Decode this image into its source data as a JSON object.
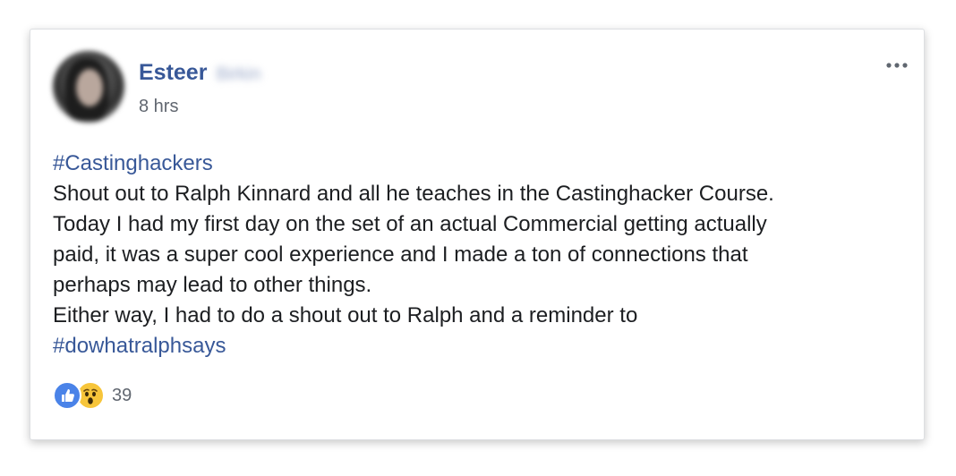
{
  "post": {
    "author_first": "Esteer",
    "author_last": "Birkin",
    "time": "8 hrs",
    "more_icon": "more-horizontal-icon",
    "hashtag_top": "#Castinghackers",
    "lines": [
      "Shout out to Ralph Kinnard and all he teaches in the Castinghacker Course.",
      "Today I had my first day on the set of an actual Commercial getting actually",
      "paid, it was a super cool experience and I made a ton of connections that",
      "perhaps may lead to other things.",
      "Either way, I had to do a shout out to Ralph and a reminder to"
    ],
    "hashtag_bottom": "#dowhatralphsays",
    "reactions": {
      "icons": [
        "like-icon",
        "wow-icon"
      ],
      "count": "39"
    }
  },
  "colors": {
    "link_blue": "#385898",
    "text": "#1c1e21",
    "meta": "#616770",
    "like": "#4a83e8",
    "wow": "#f7c53a"
  }
}
